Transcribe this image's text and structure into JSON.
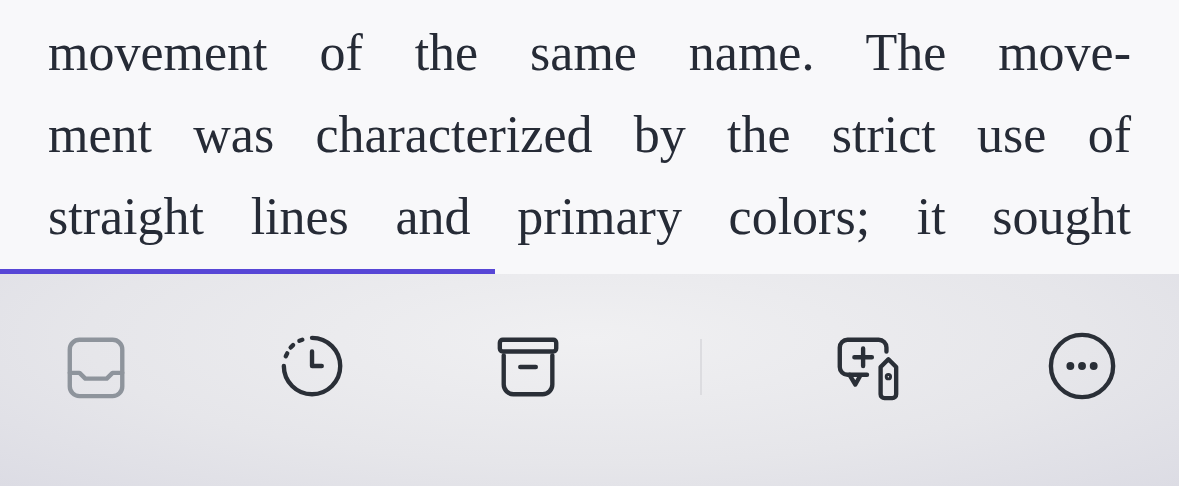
{
  "article": {
    "lines": [
      "movement of the same name. The move-",
      "ment was characterized by the strict use of",
      "straight lines and primary colors; it sought"
    ]
  },
  "reading_progress": {
    "level": 0.42
  },
  "toolbar": {
    "left": [
      {
        "kind": "inbox",
        "disabled": true
      },
      {
        "kind": "history",
        "disabled": false
      },
      {
        "kind": "archive",
        "disabled": false
      }
    ],
    "right": [
      {
        "kind": "comment-tag",
        "disabled": false
      },
      {
        "kind": "more",
        "disabled": false
      }
    ]
  }
}
